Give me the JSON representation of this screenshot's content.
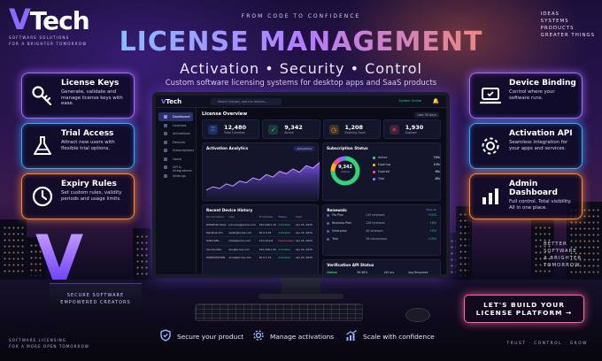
{
  "brand": {
    "logo_text": "Tech",
    "logo_mark": "V",
    "tagline_line1": "SOFTWARE SOLUTIONS",
    "tagline_line2": "FOR A BRIGHTER TOMORROW"
  },
  "header": {
    "kicker": "FROM CODE TO CONFIDENCE",
    "title": "LICENSE MANAGEMENT",
    "subtitle": "Activation • Security • Control",
    "description": "Custom software licensing systems for desktop apps and SaaS products"
  },
  "corner_list": [
    "IDEAS",
    "SYSTEMS",
    "PRODUCTS",
    "GREATER THINGS"
  ],
  "features_left": [
    {
      "title": "License Keys",
      "text": "Generate, validate and manage license keys with ease.",
      "icon": "key-icon",
      "color": "#a36bff"
    },
    {
      "title": "Trial Access",
      "text": "Attract new users with flexible trial options.",
      "icon": "flask-icon",
      "color": "#39a6ff"
    },
    {
      "title": "Expiry Rules",
      "text": "Set custom rules, validity periods and usage limits.",
      "icon": "clock-icon",
      "color": "#ff8a3a"
    }
  ],
  "features_right": [
    {
      "title": "Device Binding",
      "text": "Control where your software runs.",
      "icon": "laptop-icon",
      "color": "#a36bff"
    },
    {
      "title": "Activation API",
      "text": "Seamless integration for your apps and services.",
      "icon": "gear-icon",
      "color": "#39a6ff"
    },
    {
      "title": "Admin Dashboard",
      "text": "Full control. Total visibility. All in one place.",
      "icon": "bar-chart-icon",
      "color": "#ff8a3a"
    }
  ],
  "dashboard": {
    "logo": "Tech",
    "search_placeholder": "Search licenses, users or devices...",
    "status": "System Online",
    "sidebar": [
      "Dashboard",
      "Licenses",
      "Activations",
      "Devices",
      "Subscriptions",
      "Users",
      "API & Integrations",
      "Settings"
    ],
    "overview_title": "License Overview",
    "range": "Last 30 days",
    "stats": [
      {
        "value": "12,480",
        "label": "Total Licenses",
        "color": "#3b7dff",
        "icon": "key-icon"
      },
      {
        "value": "9,342",
        "label": "Active",
        "color": "#33d17a",
        "icon": "check-icon"
      },
      {
        "value": "1,208",
        "label": "Expiring Soon",
        "color": "#ff9d2e",
        "icon": "clock-icon"
      },
      {
        "value": "1,930",
        "label": "Expired",
        "color": "#ff4d5e",
        "icon": "close-icon"
      }
    ],
    "analytics_title": "Activation Analytics",
    "analytics_chip": "Activations",
    "subscription_title": "Subscription Status",
    "subscription_total": "9,342",
    "subscription_total_label": "Active",
    "subscription_legend": [
      {
        "label": "Active",
        "pct": "74%",
        "color": "#33d17a"
      },
      {
        "label": "Expiring",
        "pct": "10%",
        "color": "#ffb020"
      },
      {
        "label": "Expired",
        "pct": "8%",
        "color": "#ff4d8a"
      },
      {
        "label": "Trial",
        "pct": "8%",
        "color": "#8a6bff"
      }
    ],
    "devices_title": "Recent Device History",
    "devices_headers": [
      "Device Name",
      "User",
      "IP Address",
      "Status",
      "Date"
    ],
    "devices": [
      [
        "DESKTOP-7GQ1",
        "john.doe@acme.com",
        "192.168.1.10",
        "Activated",
        "Apr 25, 2025"
      ],
      [
        "MacBook-Pro",
        "sarah@acme.com",
        "10.0.0.24",
        "Activated",
        "Apr 25, 2025"
      ],
      [
        "WIN-1650...",
        "mike@acme.com",
        "172.16.0.8",
        "Deactivated",
        "Apr 25, 2025"
      ],
      [
        "Ubuntu-Dev",
        "dev@acme.com",
        "192.168.1.45",
        "Activated",
        "Apr 24, 2025"
      ],
      [
        "WORKSTATION",
        "anna@acme.com",
        "10.0.1.12",
        "Activated",
        "Apr 24, 2025"
      ]
    ],
    "renewals_title": "Renewals",
    "renewals_link": "View all",
    "renewals": [
      {
        "plan": "Pro Plan",
        "count": "245 renewals",
        "change": "+12%"
      },
      {
        "plan": "Business Plan",
        "count": "128 renewals",
        "change": "+8%"
      },
      {
        "plan": "Enterprise",
        "count": "40 renewals",
        "change": "+5%"
      },
      {
        "plan": "Trial",
        "count": "38 conversions",
        "change": "+15%"
      }
    ],
    "verify_title": "Verification API Status",
    "verify_status": "Online",
    "verify_uptime": "99.98%",
    "verify_latency": "145 ms",
    "verify_requests": "Avg Response"
  },
  "analytics_chart": {
    "type": "area",
    "values": [
      20,
      28,
      24,
      35,
      30,
      42,
      38,
      50,
      45,
      58,
      52,
      66,
      60,
      72,
      64,
      80,
      74,
      88
    ]
  },
  "bottom_features": [
    {
      "label": "Secure your product",
      "icon": "shield-icon"
    },
    {
      "label": "Manage activations",
      "icon": "gear-icon"
    },
    {
      "label": "Scale with confidence",
      "icon": "growth-chart-icon"
    }
  ],
  "pedestal": {
    "mark": "V",
    "line1": "SECURE SOFTWARE",
    "line2": "EMPOWERED CREATORS"
  },
  "side_note": [
    "BETTER",
    "SOFTWARE",
    "A BRIGHTER",
    "TOMORROW"
  ],
  "cta": {
    "line1": "LET'S BUILD YOUR",
    "line2": "LICENSE PLATFORM →"
  },
  "footer_left": [
    "SOFTWARE LICENSING",
    "FOR A MORE OPEN TOMORROW"
  ],
  "footer_right": "TRUST · CONTROL · GROW"
}
